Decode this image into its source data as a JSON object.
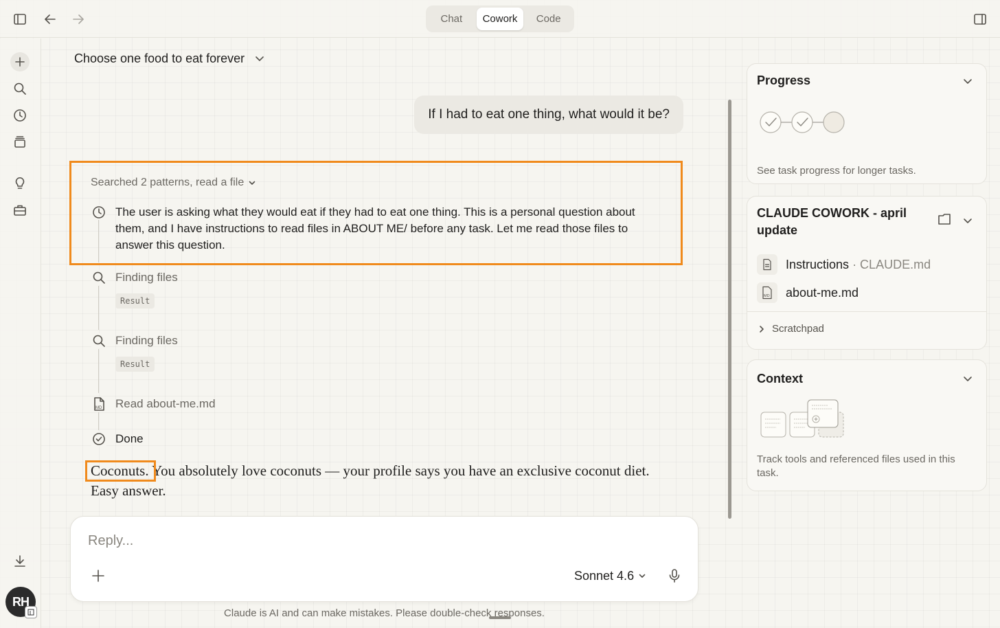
{
  "topbar": {
    "tabs": [
      {
        "label": "Chat",
        "active": false
      },
      {
        "label": "Cowork",
        "active": true
      },
      {
        "label": "Code",
        "active": false
      }
    ]
  },
  "conversation": {
    "title": "Choose one food to eat forever",
    "user_message": "If I had to eat one thing, what would it be?",
    "activity": {
      "header": "Searched 2 patterns, read a file",
      "thinking": "The user is asking what they would eat if they had to eat one thing. This is a personal question about them, and I have instructions to read files in ABOUT ME/ before any task. Let me read those files to answer this question.",
      "steps": [
        {
          "label": "Finding files",
          "chip": "Result"
        },
        {
          "label": "Finding files",
          "chip": "Result"
        },
        {
          "label": "Read about-me.md"
        },
        {
          "label": "Done"
        }
      ]
    },
    "answer_lead": "Coconuts.",
    "answer_rest": " You absolutely love coconuts — your profile says you have an exclusive coconut diet. Easy answer."
  },
  "composer": {
    "placeholder": "Reply...",
    "model": "Sonnet 4.6",
    "disclaimer": "Claude is AI and can make mistakes. Please double-check responses."
  },
  "user": {
    "initials": "RH"
  },
  "panels": {
    "progress": {
      "title": "Progress",
      "note": "See task progress for longer tasks.",
      "steps_completed": 2,
      "steps_total": 3
    },
    "project": {
      "title": "CLAUDE COWORK - april update",
      "files": [
        {
          "name": "Instructions",
          "sub": "· CLAUDE.md",
          "icon": "document-icon"
        },
        {
          "name": "about-me.md",
          "sub": "",
          "icon": "markdown-file-icon"
        }
      ],
      "scratchpad": "Scratchpad"
    },
    "context": {
      "title": "Context",
      "note": "Track tools and referenced files used in this task."
    }
  },
  "colors": {
    "highlight": "#f08a1c",
    "background": "#f6f5f0"
  }
}
